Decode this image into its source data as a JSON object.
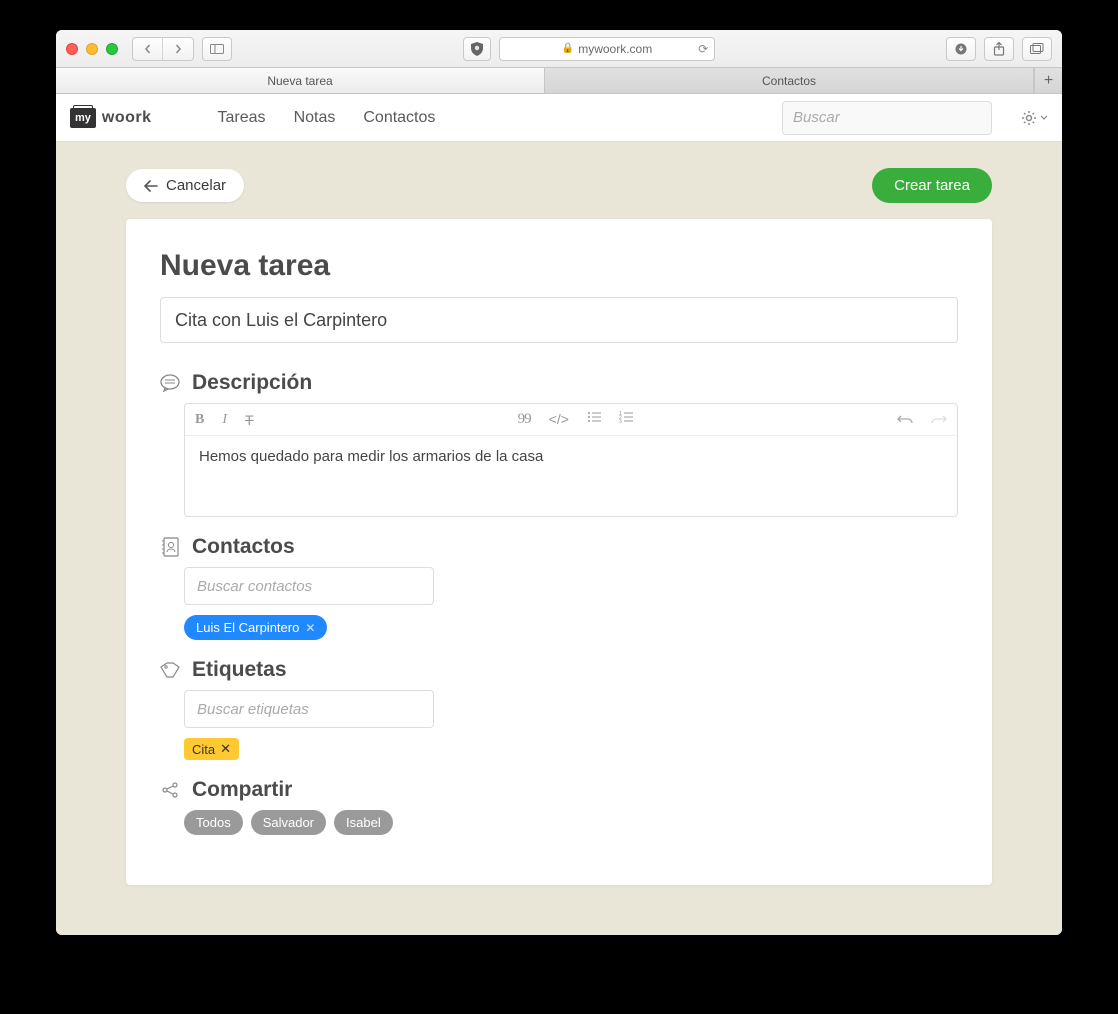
{
  "browser": {
    "url_display": "mywoork.com",
    "tabs": [
      "Nueva tarea",
      "Contactos"
    ]
  },
  "nav": {
    "logo_badge": "my",
    "logo_text": "woork",
    "links": [
      "Tareas",
      "Notas",
      "Contactos"
    ],
    "search_placeholder": "Buscar"
  },
  "actions": {
    "cancel": "Cancelar",
    "create": "Crear tarea"
  },
  "page": {
    "title": "Nueva tarea",
    "task_title_value": "Cita con Luis el Carpintero"
  },
  "description": {
    "heading": "Descripción",
    "body": "Hemos quedado para medir los armarios de la casa"
  },
  "contacts": {
    "heading": "Contactos",
    "placeholder": "Buscar contactos",
    "chips": [
      "Luis El Carpintero"
    ]
  },
  "tags": {
    "heading": "Etiquetas",
    "placeholder": "Buscar etiquetas",
    "chips": [
      "Cita"
    ]
  },
  "share": {
    "heading": "Compartir",
    "chips": [
      "Todos",
      "Salvador",
      "Isabel"
    ]
  }
}
